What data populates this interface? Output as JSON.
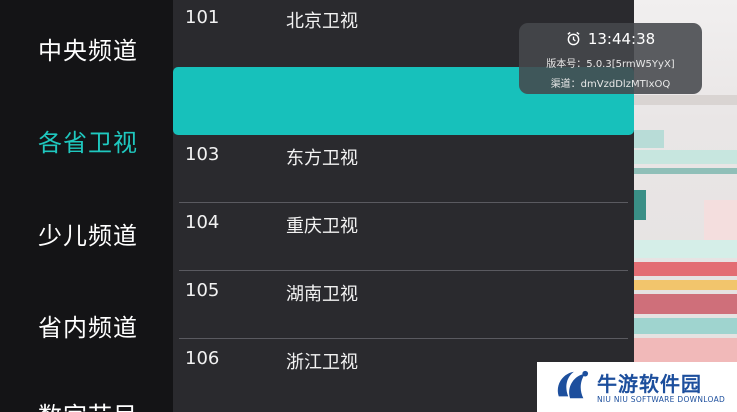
{
  "sidebar": {
    "categories": [
      {
        "label": "中央频道",
        "active": false
      },
      {
        "label": "各省卫视",
        "active": true
      },
      {
        "label": "少儿频道",
        "active": false
      },
      {
        "label": "省内频道",
        "active": false
      },
      {
        "label": "数字节目",
        "active": false
      }
    ]
  },
  "channels": [
    {
      "number": "101",
      "name": "北京卫视"
    },
    {
      "number": "",
      "name": "",
      "selected": true
    },
    {
      "number": "103",
      "name": "东方卫视"
    },
    {
      "number": "104",
      "name": "重庆卫视"
    },
    {
      "number": "105",
      "name": "湖南卫视"
    },
    {
      "number": "106",
      "name": "浙江卫视"
    }
  ],
  "info": {
    "time": "13:44:38",
    "version": "版本号：5.0.3[5rmW5YyX]",
    "channel_id": "渠道：dmVzdDlzMTIxOQ"
  },
  "watermark": {
    "name": "牛游软件园",
    "subtitle": "NIU NIU SOFTWARE DOWNLOAD"
  },
  "colors": {
    "accent": "#17c1bb",
    "active_text": "#1fc8bf",
    "watermark": "#1d4f9d"
  }
}
